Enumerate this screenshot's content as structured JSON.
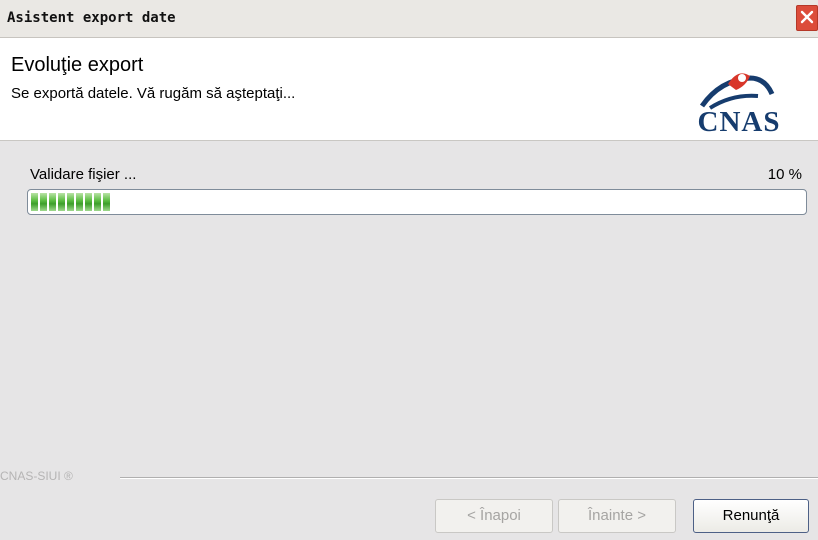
{
  "window": {
    "title": "Asistent export date"
  },
  "header": {
    "title": "Evoluţie export",
    "subtitle": "Se exportă datele. Vă rugăm să aşteptaţi...",
    "logo_text": "CNAS"
  },
  "progress": {
    "label": "Validare fişier ...",
    "percent_text": "10 %",
    "value": 0.1,
    "bar_color": "#4aaa35"
  },
  "footer": {
    "brand": "CNAS-SIUI ®",
    "back_label": "< Înapoi",
    "next_label": "Înainte >",
    "cancel_label": "Renunţă"
  },
  "icons": {
    "close": "close-icon",
    "logo": "cnas-logo-icon"
  },
  "colors": {
    "close_button": "#dc4c3a",
    "logo_blue": "#163c6e",
    "logo_red": "#d8362a"
  }
}
